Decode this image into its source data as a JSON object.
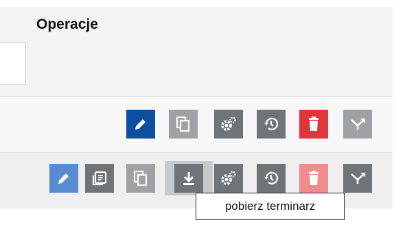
{
  "header": {
    "title": "Operacje"
  },
  "colors": {
    "edit_blue": "#0b4ea2",
    "edit_blue_hover": "#5a8bd0",
    "dark_gray": "#6e7478",
    "light_gray": "#9ea2a5",
    "red": "#e2353b",
    "red_faded": "#f08b8e"
  },
  "rows": [
    {
      "actions": [
        "edit-icon",
        "copy-icon",
        "settings-icon",
        "history-icon",
        "delete-icon",
        "merge-icon"
      ]
    },
    {
      "actions": [
        "edit-icon",
        "details-icon",
        "copy-icon",
        "download-icon",
        "settings-icon",
        "history-icon",
        "delete-icon",
        "merge-icon"
      ]
    }
  ],
  "tooltip": {
    "text": "pobierz terminarz"
  }
}
